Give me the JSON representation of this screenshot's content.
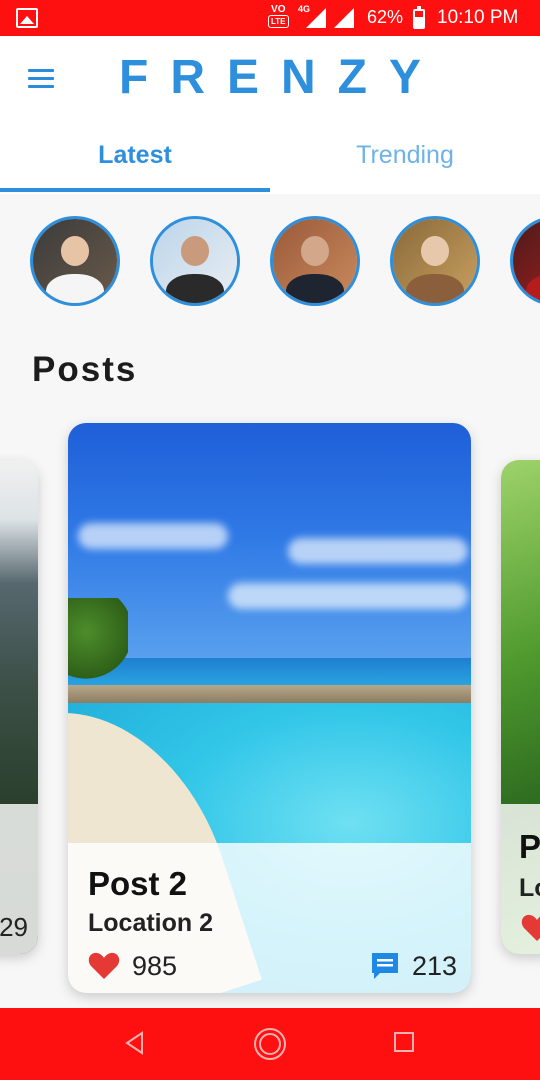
{
  "status_bar": {
    "volte_top": "VO",
    "volte_bottom": "LTE",
    "network": "4G",
    "battery": "62%",
    "time": "10:10 PM",
    "background": "#ff1010"
  },
  "app_bar": {
    "title": "FRENZY",
    "menu_icon": "menu-icon",
    "accent": "#2e8fdd"
  },
  "tabs": [
    {
      "label": "Latest",
      "selected": true
    },
    {
      "label": "Trending",
      "selected": false
    }
  ],
  "stories": [
    {
      "icon": "avatar"
    },
    {
      "icon": "avatar"
    },
    {
      "icon": "avatar"
    },
    {
      "icon": "avatar"
    },
    {
      "icon": "avatar"
    }
  ],
  "section_title": "Posts",
  "posts": {
    "previous": {
      "comments": "29"
    },
    "current": {
      "title": "Post 2",
      "location": "Location 2",
      "likes": "985",
      "comments": "213"
    },
    "next": {
      "title": "P",
      "location": "Lo"
    }
  },
  "nav_bar": {
    "back_icon": "back-icon",
    "home_icon": "home-icon",
    "recents_icon": "recents-icon"
  }
}
